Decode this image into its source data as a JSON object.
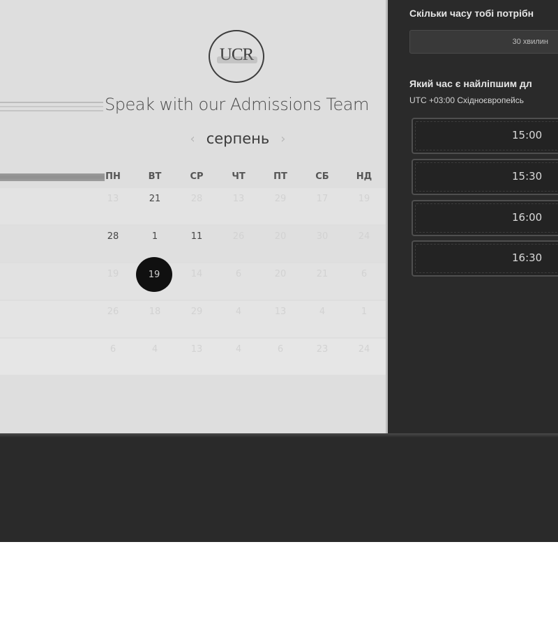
{
  "logo": {
    "text": "UCR"
  },
  "title": "Speak with our Admissions Team",
  "calendar": {
    "month": "серпень",
    "prev_icon": "chevron-left-icon",
    "next_icon": "chevron-right-icon",
    "weekdays": [
      "ПН",
      "ВТ",
      "СР",
      "ЧТ",
      "ПТ",
      "СБ",
      "НД"
    ],
    "rows": [
      [
        "13",
        "21",
        "28",
        "13",
        "29",
        "17",
        "19"
      ],
      [
        "28",
        "1",
        "11",
        "26",
        "20",
        "30",
        "24"
      ],
      [
        "19",
        "19",
        "14",
        "6",
        "20",
        "21",
        "6"
      ],
      [
        "26",
        "18",
        "29",
        "4",
        "13",
        "4",
        "1"
      ],
      [
        "6",
        "4",
        "13",
        "4",
        "6",
        "23",
        "24"
      ]
    ],
    "selected": "19"
  },
  "sidebar": {
    "duration_question": "Скільки часу тобі потрібн",
    "duration_value": "30 хвилин",
    "time_question": "Який час є найліпшим дл",
    "timezone": "UTC +03:00 Східноєвропейсь",
    "slots": [
      "15:00",
      "15:30",
      "16:00",
      "16:30"
    ]
  },
  "colors": {
    "light_panel": "#dedede",
    "dark_panel": "#2a2a2a",
    "selected_day": "#101010"
  }
}
